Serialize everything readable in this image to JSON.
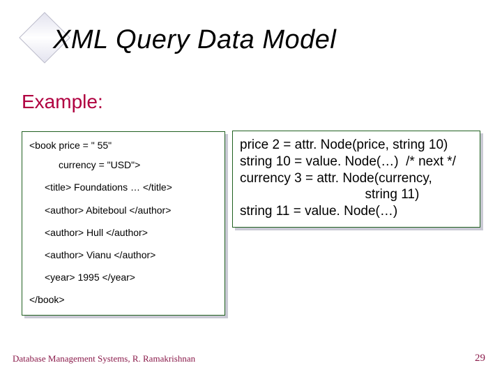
{
  "title": "XML Query Data Model",
  "example_label": "Example:",
  "xml": {
    "l1": "<book price = \" 55\"",
    "l2": "currency  = \"USD\">",
    "l3": "<title> Foundations … </title>",
    "l4": "<author> Abiteboul </author>",
    "l5": "<author> Hull </author>",
    "l6": "<author> Vianu </author>",
    "l7": "<year> 1995 </year>",
    "l8": "</book>"
  },
  "code": {
    "c1": "price 2 = attr. Node(price, string 10)",
    "c2": "string 10 = value. Node(…)  /* next */",
    "c3": "currency 3 = attr. Node(currency,",
    "c4": "                                  string 11)",
    "c5": "string 11 = value. Node(…)"
  },
  "footer_left": "Database Management Systems, R. Ramakrishnan",
  "footer_right": "29"
}
